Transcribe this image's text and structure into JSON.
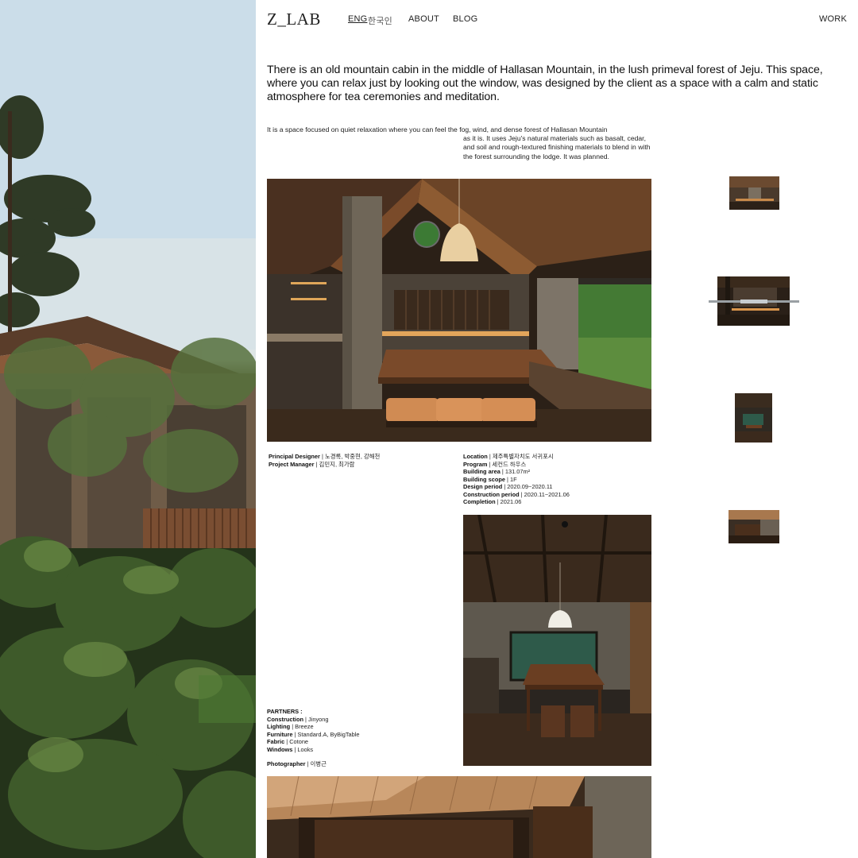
{
  "brand": {
    "logo": "Z_LAB"
  },
  "nav": {
    "lang_eng": "ENG",
    "lang_kor": "한국인",
    "about": "ABOUT",
    "blog": "BLOG",
    "work": "WORK"
  },
  "intro": "There is an old mountain cabin in the middle of Hallasan Mountain, in the lush primeval forest of Jeju. This space, where you can relax just by looking out the window, was designed by the client as a space with a calm and static atmosphere for tea ceremonies and meditation.",
  "description": {
    "line1": "It is a space focused on quiet relaxation where you can feel the fog, wind, and dense forest of Hallasan Mountain",
    "line2": " as it is. It uses Jeju's natural materials such as basalt, cedar, and soil and rough-textured finishing materials to blend in with the forest surrounding the lodge. It was planned."
  },
  "credits": {
    "principal_designer_label": "Principal Designer",
    "principal_designer": " | 노경록, 박중현, 강해천",
    "project_manager_label": "Project Manager",
    "project_manager": " | 김민지, 최가람",
    "location_label": "Location",
    "location": " | 제주특별자치도 서귀포시",
    "program_label": "Program",
    "program": " | 세컨드 하우스",
    "building_area_label": "Building area",
    "building_area": " | 131.07m²",
    "building_scope_label": "Building scope",
    "building_scope": " | 1F",
    "design_period_label": "Design period",
    "design_period": " | 2020.09~2020.11",
    "construction_period_label": "Construction period",
    "construction_period": " | 2020.11~2021.06",
    "completion_label": "Completion",
    "completion": " | 2021.06"
  },
  "partners": {
    "heading": "PARTNERS :",
    "construction_label": "Construction",
    "construction": " | Jinyong",
    "lighting_label": "Lighting",
    "lighting": " | Breeze",
    "furniture_label": "Furniture",
    "furniture": " | Standard.A, ByBigTable",
    "fabric_label": "Fabric",
    "fabric": " | Cotone",
    "windows_label": "Windows",
    "windows": " | Looks",
    "photographer_label": "Photographer",
    "photographer": " | 이병근"
  },
  "colors": {
    "text": "#111111",
    "wood_dark": "#3a2a1c",
    "wood_warm": "#8a5a33",
    "cushion": "#d9935a",
    "forest": "#3f6b2f"
  }
}
